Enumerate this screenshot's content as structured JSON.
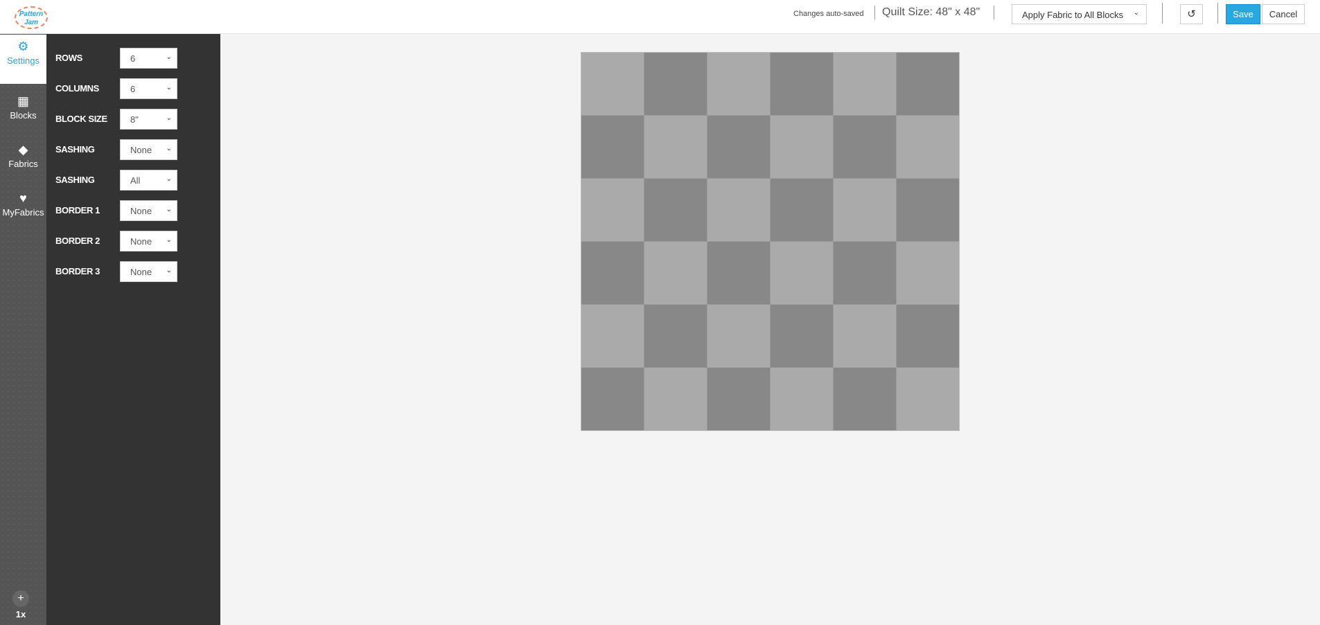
{
  "header": {
    "logo_text": "Pattern Jam",
    "autosave_status": "Changes auto-saved",
    "quilt_size": "Quilt Size: 48\" x 48\"",
    "apply_select": "Apply Fabric to All Blocks",
    "undo_icon": "undo-icon",
    "save_label": "Save",
    "cancel_label": "Cancel"
  },
  "rail": {
    "tabs": [
      {
        "label": "Settings",
        "icon": "gear-icon",
        "active": true
      },
      {
        "label": "Blocks",
        "icon": "grid-icon"
      },
      {
        "label": "Fabrics",
        "icon": "tag-icon"
      },
      {
        "label": "MyFabrics",
        "icon": "heart-icon"
      }
    ],
    "add_label": "+",
    "zoom_label": "1x"
  },
  "settings": [
    {
      "label": "ROWS",
      "value": "6"
    },
    {
      "label": "COLUMNS",
      "value": "6"
    },
    {
      "label": "BLOCK SIZE",
      "value": "8\""
    },
    {
      "label": "SASHING",
      "value": "None"
    },
    {
      "label": "SASHING",
      "value": "All"
    },
    {
      "label": "BORDER 1",
      "value": "None"
    },
    {
      "label": "BORDER 2",
      "value": "None"
    },
    {
      "label": "BORDER 3",
      "value": "None"
    }
  ],
  "quilt": {
    "rows": 6,
    "columns": 6,
    "colors": {
      "light": "#aaaaaa",
      "dark": "#888888"
    }
  },
  "colors": {
    "accent": "#29a8e0",
    "panel": "#333333"
  }
}
